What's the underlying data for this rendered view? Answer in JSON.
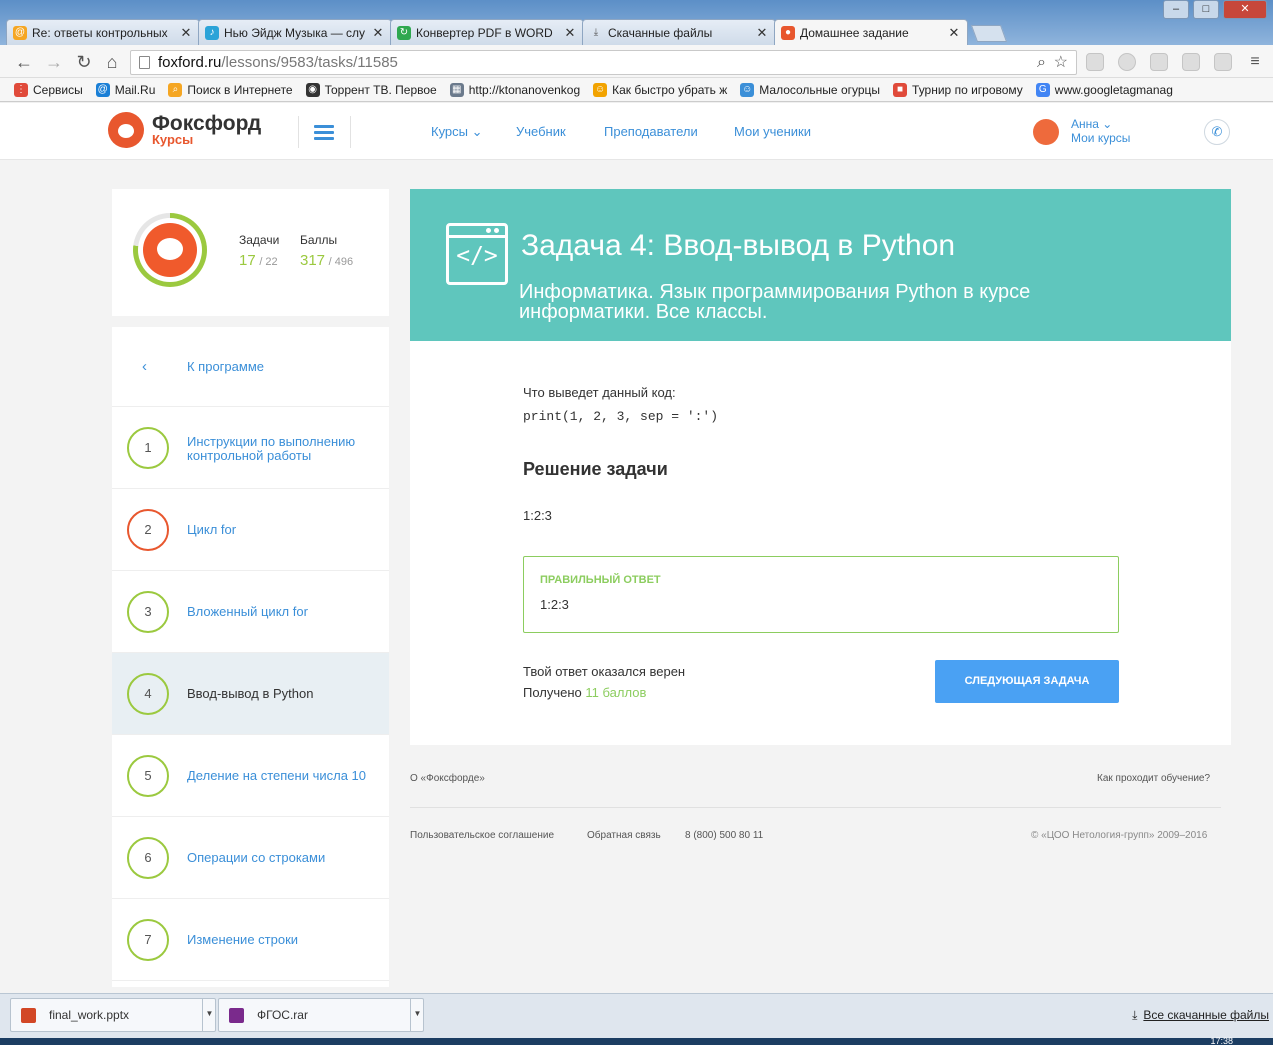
{
  "browser": {
    "tabs": [
      {
        "title": "Re: ответы контрольных",
        "icon": "mail-icon",
        "color": "#f5a623"
      },
      {
        "title": "Нью Эйдж Музыка — слу",
        "icon": "music-icon",
        "color": "#2aa3d8"
      },
      {
        "title": "Конвертер PDF в WORD",
        "icon": "converter-icon",
        "color": "#2fa84f"
      },
      {
        "title": "Скачанные файлы",
        "icon": "download-icon",
        "color": "#555555"
      },
      {
        "title": "Домашнее задание",
        "icon": "foxford-icon",
        "color": "#e8572e",
        "active": true
      }
    ],
    "window_controls": {
      "minimize": "–",
      "maximize": "□",
      "close": "✕"
    },
    "url_host": "foxford.ru",
    "url_path": "/lessons/9583/tasks/11585",
    "bookmarks": [
      {
        "label": "Сервисы",
        "icon": "apps-icon",
        "color": "#e04a3a"
      },
      {
        "label": "Mail.Ru",
        "icon": "mailru-icon",
        "color": "#1a7fd6"
      },
      {
        "label": "Поиск в Интернете",
        "icon": "search-icon",
        "color": "#f5a623"
      },
      {
        "label": "Торрент ТВ. Первое",
        "icon": "eye-icon",
        "color": "#333333"
      },
      {
        "label": "http://ktonanovenkog",
        "icon": "grid-icon",
        "color": "#6b7a8c"
      },
      {
        "label": "Как быстро убрать ж",
        "icon": "person-icon",
        "color": "#f2a300"
      },
      {
        "label": "Малосольные огурцы",
        "icon": "person-icon",
        "color": "#3b8fd8"
      },
      {
        "label": "Турнир по игровому",
        "icon": "windows-icon",
        "color": "#e04a3a"
      },
      {
        "label": "www.googletagmanag",
        "icon": "google-icon",
        "color": "#4285f4"
      }
    ]
  },
  "header": {
    "logo_title": "Фоксфорд",
    "logo_sub": "Курсы",
    "nav": [
      "Курсы",
      "Учебник",
      "Преподаватели",
      "Мои ученики"
    ],
    "user_name": "Анна",
    "user_courses": "Мои курсы"
  },
  "profile": {
    "tasks_label": "Задачи",
    "tasks_value": "17",
    "tasks_total": "/ 22",
    "points_label": "Баллы",
    "points_value": "317",
    "points_total": "/ 496",
    "progress": 0.77
  },
  "sidebar": {
    "back_label": "К программе",
    "lessons": [
      {
        "num": "1",
        "name": "Инструкции по выполнению контрольной работы",
        "state": "done"
      },
      {
        "num": "2",
        "name": "Цикл for",
        "state": "wrong"
      },
      {
        "num": "3",
        "name": "Вложенный цикл for",
        "state": "done"
      },
      {
        "num": "4",
        "name": "Ввод-вывод в Python",
        "state": "active"
      },
      {
        "num": "5",
        "name": "Деление на степени числа 10",
        "state": "done"
      },
      {
        "num": "6",
        "name": "Операции со строками",
        "state": "done"
      },
      {
        "num": "7",
        "name": "Изменение строки",
        "state": "done"
      }
    ]
  },
  "task": {
    "title": "Задача 4: Ввод-вывод в Python",
    "subtitle": "Информатика. Язык программирования Python в курсе информатики. Все классы.",
    "question": "Что выведет данный код:",
    "code": "print(1, 2, 3, sep = ':')",
    "solution_heading": "Решение задачи",
    "solution": "1:2:3",
    "correct_label": "ПРАВИЛЬНЫЙ ОТВЕТ",
    "correct_value": "1:2:3",
    "result_text": "Твой ответ оказался верен",
    "points_prefix": "Получено",
    "points_value": "11 баллов",
    "next_button": "СЛЕДУЮЩАЯ ЗАДАЧА"
  },
  "footer": {
    "about": "О «Фоксфорде»",
    "how": "Как проходит обучение?",
    "agreement": "Пользовательское соглашение",
    "feedback": "Обратная связь",
    "phone": "8 (800) 500 80 11",
    "copyright": "© «ЦОО Нетология-групп» 2009–2016"
  },
  "downloads": {
    "items": [
      {
        "name": "final_work.pptx",
        "icon": "pptx-icon",
        "color": "#d24726"
      },
      {
        "name": "ФГОС.rar",
        "icon": "rar-icon",
        "color": "#7a2a8c"
      }
    ],
    "all_label": "Все скачанные файлы"
  },
  "taskbar": {
    "clock": "17:38"
  },
  "colors": {
    "accent": "#3b8fd8",
    "hero": "#5fc6bd",
    "success": "#8ccd5f",
    "button": "#4aa1f3",
    "brand": "#e8572e"
  }
}
